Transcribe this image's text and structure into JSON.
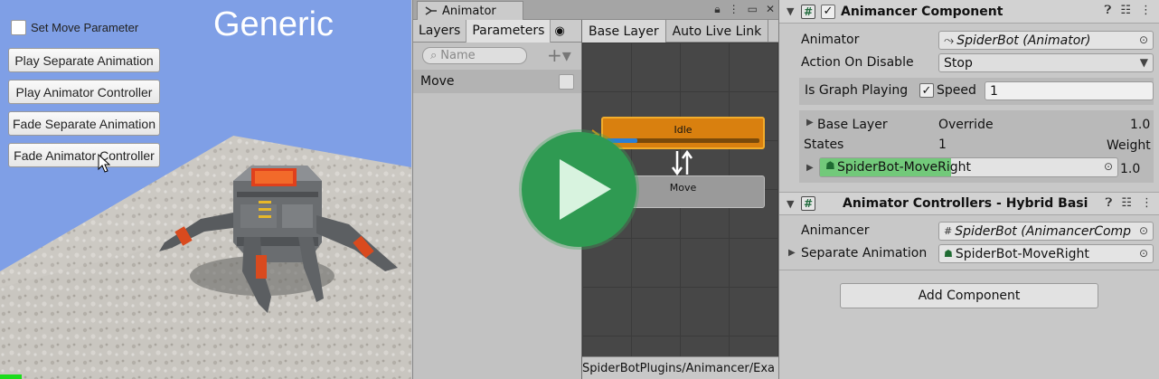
{
  "game": {
    "title": "Generic",
    "set_move_parameter_label": "Set Move Parameter",
    "buttons": {
      "play_separate": "Play Separate Animation",
      "play_controller": "Play Animator Controller",
      "fade_separate": "Fade Separate Animation",
      "fade_controller": "Fade Animator Controller"
    }
  },
  "animator": {
    "tab_title": "Animator",
    "tab_icons": [
      "lock-icon",
      "more-icon",
      "maximize-icon",
      "close-icon"
    ],
    "subtabs": {
      "layers": "Layers",
      "parameters": "Parameters"
    },
    "search_placeholder": "Name",
    "parameter": {
      "name": "Move",
      "value": false
    },
    "graph_tabs": {
      "base_layer": "Base Layer",
      "auto_live_link": "Auto Live Link"
    },
    "states": {
      "idle": "Idle",
      "move": "Move"
    },
    "idle_progress": 0.2,
    "status_path": "SpiderBotPlugins/Animancer/Exa"
  },
  "inspector": {
    "animancer_component": {
      "title": "Animancer Component",
      "enabled": true,
      "animator_label": "Animator",
      "animator_value": "SpiderBot (Animator)",
      "action_on_disable_label": "Action On Disable",
      "action_on_disable_value": "Stop",
      "is_graph_playing_label": "Is Graph Playing",
      "is_graph_playing": true,
      "speed_label": "Speed",
      "speed_value": "1",
      "base_layer_label": "Base Layer",
      "base_layer_mode": "Override",
      "base_layer_weight": "1.0",
      "states_label": "States",
      "states_count": "1",
      "weight_header": "Weight",
      "state_name": "SpiderBot-MoveRight",
      "state_progress": 0.44,
      "state_weight": "1.0"
    },
    "controllers_component": {
      "title": "Animator Controllers - Hybrid Basi",
      "animancer_label": "Animancer",
      "animancer_value": "SpiderBot (AnimancerComp",
      "separate_animation_label": "Separate Animation",
      "separate_animation_value": "SpiderBot-MoveRight"
    },
    "add_component_label": "Add Component",
    "header_icons": [
      "help-icon",
      "settings-sliders-icon",
      "more-icon"
    ]
  },
  "colors": {
    "sky": "#7f9fe6",
    "idle_state": "#d9800f",
    "play_overlay": "#2f9a52",
    "state_progress_green": "#72c97a"
  }
}
